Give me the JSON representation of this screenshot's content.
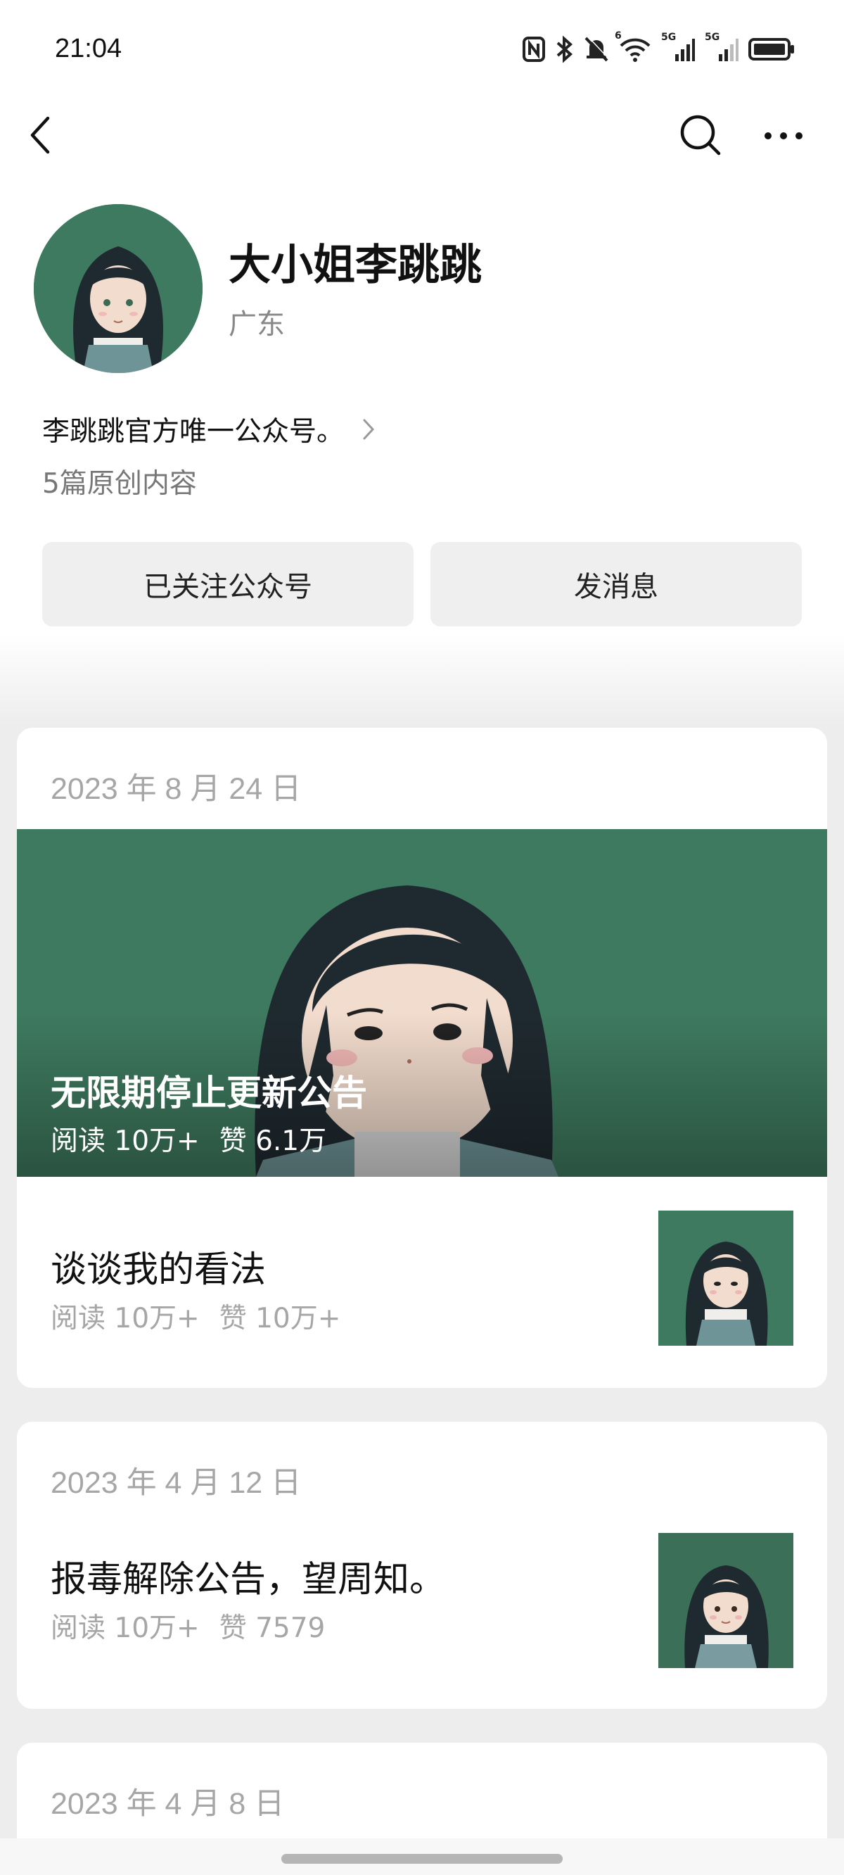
{
  "status_bar": {
    "time": "21:04",
    "icons": [
      "nfc-icon",
      "bluetooth-icon",
      "mute-icon",
      "wifi-icon",
      "signal-5g-icon",
      "signal-5g-icon",
      "battery-icon"
    ],
    "wifi_badge": "6",
    "sim1_badge": "5G",
    "sim2_badge": "5G"
  },
  "nav": {
    "back_icon": "chevron-left-icon",
    "search_icon": "search-icon",
    "more_icon": "more-dots-icon"
  },
  "profile": {
    "name": "大小姐李跳跳",
    "region": "广东",
    "bio": "李跳跳官方唯一公众号。",
    "original_count": "5篇原创内容"
  },
  "actions": {
    "followed_label": "已关注公众号",
    "message_label": "发消息"
  },
  "posts": [
    {
      "date": "2023 年 8 月 24 日",
      "featured": {
        "title": "无限期停止更新公告",
        "reads": "阅读 10万+",
        "likes": "赞 6.1万"
      },
      "items": [
        {
          "title": "谈谈我的看法",
          "reads": "阅读 10万+",
          "likes": "赞 10万+"
        }
      ]
    },
    {
      "date": "2023 年 4 月 12 日",
      "items": [
        {
          "title": "报毒解除公告，望周知。",
          "reads": "阅读 10万+",
          "likes": "赞 7579"
        }
      ]
    },
    {
      "date": "2023 年 4 月 8 日",
      "items": []
    }
  ],
  "colors": {
    "brand_green": "#3e7a5f",
    "page_bg": "#ededed",
    "button_bg": "#efefef",
    "muted_text": "#a6a6a6"
  }
}
